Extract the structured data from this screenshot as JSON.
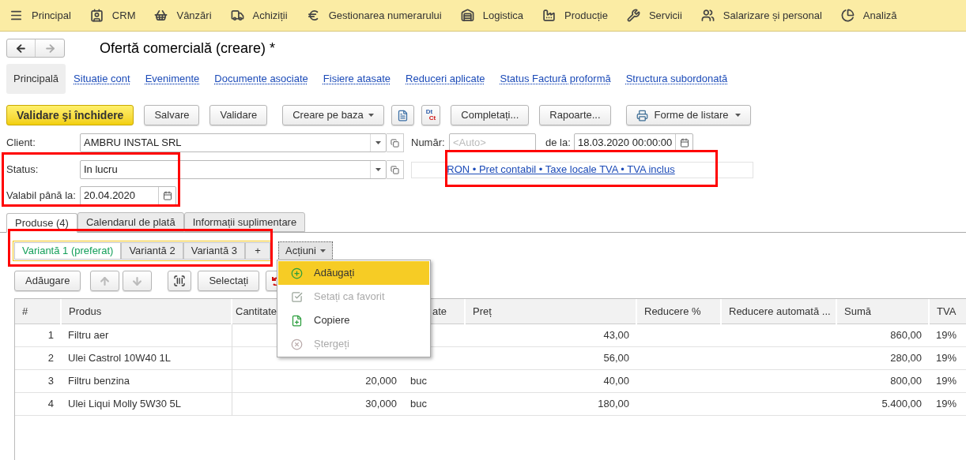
{
  "menu_bar": [
    {
      "label": "Principal"
    },
    {
      "label": "CRM"
    },
    {
      "label": "Vânzări"
    },
    {
      "label": "Achiziții"
    },
    {
      "label": "Gestionarea numerarului"
    },
    {
      "label": "Logistica"
    },
    {
      "label": "Producție"
    },
    {
      "label": "Servicii"
    },
    {
      "label": "Salarizare și personal"
    },
    {
      "label": "Analiză"
    }
  ],
  "title": "Ofertă comercială (creare) *",
  "sections": [
    {
      "label": "Principală",
      "selected": true
    },
    {
      "label": "Situație cont",
      "selected": false
    },
    {
      "label": "Evenimente",
      "selected": false
    },
    {
      "label": "Documente asociate",
      "selected": false
    },
    {
      "label": "Fisiere atasate",
      "selected": false
    },
    {
      "label": "Reduceri aplicate",
      "selected": false
    },
    {
      "label": "Status Factură proformă",
      "selected": false
    },
    {
      "label": "Structura subordonată",
      "selected": false
    }
  ],
  "toolbar": [
    {
      "kind": "primary",
      "label": "Validare şi închidere"
    },
    {
      "kind": "button",
      "label": "Salvare"
    },
    {
      "kind": "button",
      "label": "Validare"
    },
    {
      "kind": "dropdown",
      "label": "Creare pe baza"
    },
    {
      "kind": "report"
    },
    {
      "kind": "dtct",
      "labels": [
        "Dt",
        "Ct"
      ]
    },
    {
      "kind": "button",
      "label": "Completați..."
    },
    {
      "kind": "button",
      "label": "Rapoarte..."
    },
    {
      "kind": "print",
      "label": "Forme de listare"
    }
  ],
  "client": {
    "label": "Client:",
    "value": "AMBRU INSTAL SRL"
  },
  "number": {
    "label": "Număr:",
    "placeholder": "<Auto>"
  },
  "date": {
    "label": "de la:",
    "value": "18.03.2020 00:00:00"
  },
  "status": {
    "label": "Status:",
    "value": "In lucru"
  },
  "pricing_link": "RON • Pret contabil • Taxe locale TVA • TVA inclus",
  "valid_until": {
    "label": "Valabil până la:",
    "value": "20.04.2020"
  },
  "tabs": [
    {
      "label": "Produse (4)",
      "selected": true
    },
    {
      "label": "Calendarul de plată",
      "selected": false
    },
    {
      "label": "Informații suplimentare",
      "selected": false
    }
  ],
  "variants": [
    {
      "label": "Variantă 1 (preferat)",
      "selected": true
    },
    {
      "label": "Variantă 2",
      "selected": false
    },
    {
      "label": "Variantă 3",
      "selected": false
    }
  ],
  "add_variant": "+",
  "actions_button": "Acțiuni",
  "row_toolbar": {
    "add": "Adăugare",
    "select": "Selectați"
  },
  "actions_menu": [
    {
      "label": "Adăugați",
      "selected": true,
      "disabled": false
    },
    {
      "label": "Setați ca favorit",
      "selected": false,
      "disabled": true
    },
    {
      "label": "Copiere",
      "selected": false,
      "disabled": false
    },
    {
      "label": "Ștergeți",
      "selected": false,
      "disabled": true
    }
  ],
  "table": {
    "columns": [
      "#",
      "Produs",
      "Cantitate",
      "ate",
      "Preț",
      "Reducere %",
      "Reducere automată ...",
      "Sumă",
      "TVA"
    ],
    "rows": [
      {
        "n": "1",
        "product": "Filtru aer",
        "price": "43,00",
        "sum": "860,00",
        "vat": "19%"
      },
      {
        "n": "2",
        "product": "Ulei Castrol 10W40 1L",
        "price": "56,00",
        "sum": "280,00",
        "vat": "19%"
      },
      {
        "n": "3",
        "product": "Filtru benzina",
        "quantity": "20,000",
        "unit": "buc",
        "price": "40,00",
        "sum": "800,00",
        "vat": "19%"
      },
      {
        "n": "4",
        "product": "Ulei Liqui Molly 5W30 5L",
        "quantity": "30,000",
        "unit": "buc",
        "price": "180,00",
        "sum": "5.400,00",
        "vat": "19%"
      }
    ]
  }
}
